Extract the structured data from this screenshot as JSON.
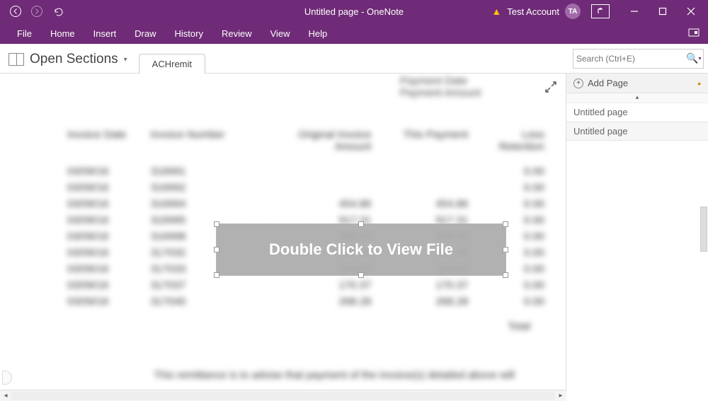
{
  "titlebar": {
    "title": "Untitled page  -  OneNote",
    "account_name": "Test Account",
    "avatar_initials": "TA"
  },
  "menu": {
    "items": [
      "File",
      "Home",
      "Insert",
      "Draw",
      "History",
      "Review",
      "View",
      "Help"
    ]
  },
  "sectionbar": {
    "dropdown_label": "Open Sections",
    "active_tab": "ACHremit"
  },
  "search": {
    "placeholder": "Search (Ctrl+E)"
  },
  "right_pane": {
    "add_page_label": "Add Page",
    "pages": [
      "Untitled page",
      "Untitled page"
    ],
    "active_index": 1
  },
  "embed": {
    "label": "Double Click to View File"
  },
  "doc": {
    "header_lines": [
      "Payment Date",
      "Payment Amount"
    ],
    "columns": [
      "Invoice Date",
      "Invoice Number",
      "Original Invoice Amount",
      "This Payment",
      "Less Retention"
    ],
    "rows": [
      {
        "date": "03/09/16",
        "num": "316991",
        "oia": "",
        "pay": "",
        "less": "0.00"
      },
      {
        "date": "03/09/16",
        "num": "316992",
        "oia": "",
        "pay": "",
        "less": "0.00"
      },
      {
        "date": "03/09/16",
        "num": "316994",
        "oia": "454.86",
        "pay": "454.86",
        "less": "0.00"
      },
      {
        "date": "03/09/16",
        "num": "316995",
        "oia": "917.31",
        "pay": "917.31",
        "less": "0.00"
      },
      {
        "date": "03/09/16",
        "num": "316998",
        "oia": "408.30",
        "pay": "408.30",
        "less": "0.00"
      },
      {
        "date": "03/09/16",
        "num": "317032",
        "oia": "797.39",
        "pay": "797.39",
        "less": "0.00"
      },
      {
        "date": "03/09/16",
        "num": "317033",
        "oia": "194.80",
        "pay": "194.80",
        "less": "0.00"
      },
      {
        "date": "03/09/16",
        "num": "317037",
        "oia": "170.37",
        "pay": "170.37",
        "less": "0.00"
      },
      {
        "date": "03/09/16",
        "num": "317040",
        "oia": "268.28",
        "pay": "268.28",
        "less": "0.00"
      }
    ],
    "total_label": "Total",
    "footnote": "This remittance is to advise that payment of the invoice(s) detailed above will"
  }
}
